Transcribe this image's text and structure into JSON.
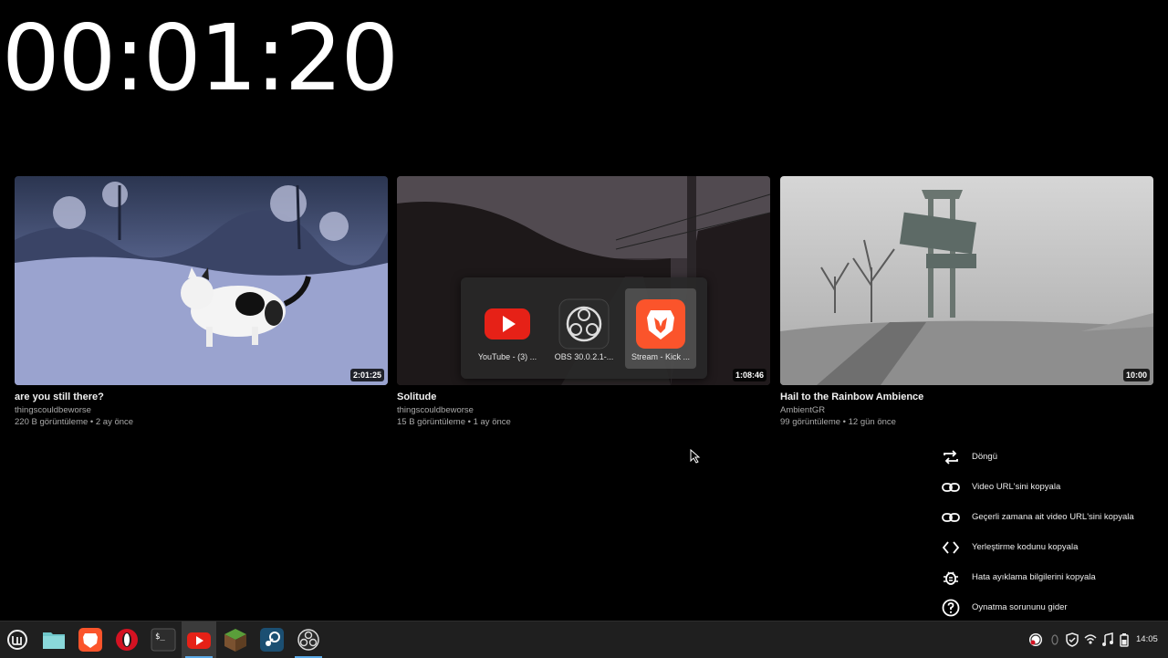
{
  "timer": "00:01:20",
  "videos": [
    {
      "title": "are you still there?",
      "channel": "thingscouldbeworse",
      "meta": "220 B görüntüleme • 2 ay önce",
      "duration": "2:01:25"
    },
    {
      "title": "Solitude",
      "channel": "thingscouldbeworse",
      "meta": "15 B görüntüleme • 1 ay önce",
      "duration": "1:08:46"
    },
    {
      "title": "Hail to the Rainbow Ambience",
      "channel": "AmbientGR",
      "meta": "99 görüntüleme • 12 gün önce",
      "duration": "10:00"
    }
  ],
  "app_switcher": {
    "items": [
      {
        "label": "YouTube - (3) ...",
        "icon": "youtube-icon"
      },
      {
        "label": "OBS 30.0.2.1-...",
        "icon": "obs-icon"
      },
      {
        "label": "Stream - Kick ...",
        "icon": "brave-icon",
        "selected": true
      }
    ]
  },
  "context_menu": {
    "items": [
      {
        "label": "Döngü",
        "icon": "loop-icon"
      },
      {
        "label": "Video URL'sini kopyala",
        "icon": "link-icon"
      },
      {
        "label": "Geçerli zamana ait video URL'sini kopyala",
        "icon": "link-icon"
      },
      {
        "label": "Yerleştirme kodunu kopyala",
        "icon": "code-icon"
      },
      {
        "label": "Hata ayıklama bilgilerini kopyala",
        "icon": "bug-icon"
      },
      {
        "label": "Oynatma sorununu gider",
        "icon": "help-icon"
      }
    ]
  },
  "taskbar": {
    "apps": [
      "mint-menu-icon",
      "files-icon",
      "brave-icon",
      "opera-icon",
      "terminal-icon",
      "youtube-icon",
      "minecraft-icon",
      "steam-icon",
      "obs-icon"
    ],
    "tray": [
      "obs-tray-icon",
      "shield-icon",
      "wifi-icon",
      "music-icon",
      "battery-icon"
    ],
    "clock": "14:05"
  },
  "colors": {
    "youtube_red": "#e62117",
    "brave_orange": "#fb542b",
    "taskbar_accent": "#5aa9e6"
  }
}
